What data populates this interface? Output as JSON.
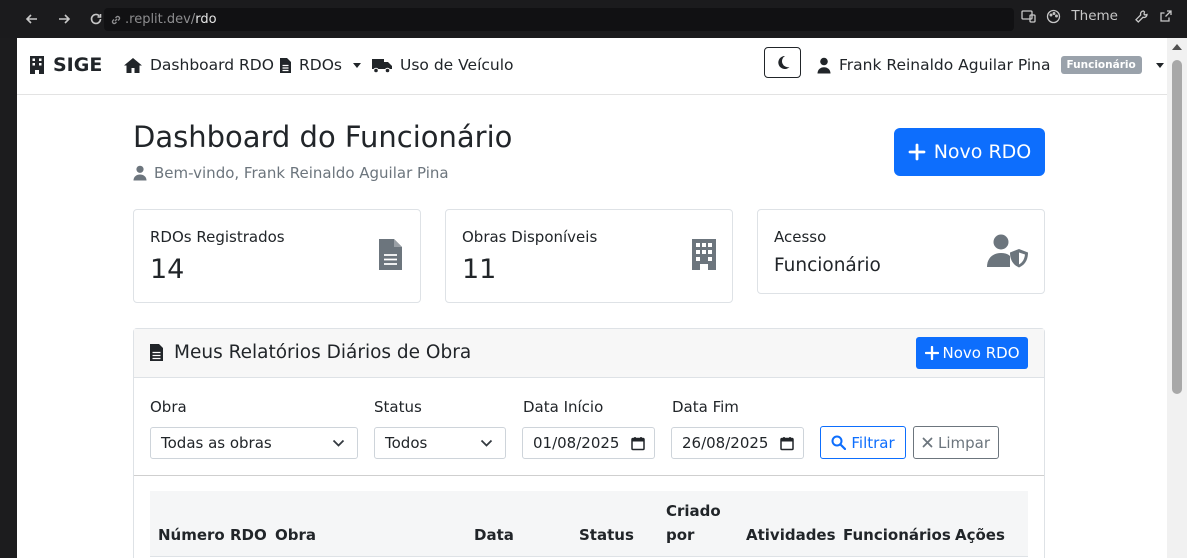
{
  "browser": {
    "url_domain": ".replit.dev/",
    "url_path": "rdo",
    "theme_label": "Theme"
  },
  "navbar": {
    "brand": "SIGE",
    "links": [
      {
        "label": "Dashboard RDO",
        "icon": "home-icon"
      },
      {
        "label": "RDOs",
        "icon": "file-icon",
        "dropdown": true
      },
      {
        "label": "Uso de Veículo",
        "icon": "truck-icon"
      }
    ],
    "user_name": "Frank Reinaldo Aguilar Pina",
    "user_role_badge": "Funcionário"
  },
  "header": {
    "title": "Dashboard do Funcionário",
    "welcome": "Bem-vindo, Frank Reinaldo Aguilar Pina",
    "new_rdo_button": "Novo RDO"
  },
  "stats": [
    {
      "label": "RDOs Registrados",
      "value": "14",
      "icon": "file-icon"
    },
    {
      "label": "Obras Disponíveis",
      "value": "11",
      "icon": "building-icon"
    },
    {
      "label": "Acesso",
      "value": "Funcionário",
      "icon": "user-shield-icon"
    }
  ],
  "panel": {
    "title": "Meus Relatórios Diários de Obra",
    "new_button": "Novo RDO",
    "filters": {
      "obra_label": "Obra",
      "obra_value": "Todas as obras",
      "status_label": "Status",
      "status_value": "Todos",
      "date_start_label": "Data Início",
      "date_start_value": "01/08/2025",
      "date_end_label": "Data Fim",
      "date_end_value": "26/08/2025",
      "filter_button": "Filtrar",
      "clear_button": "Limpar"
    },
    "table": {
      "columns": [
        "Número RDO",
        "Obra",
        "Data",
        "Status",
        "Criado por",
        "Atividades",
        "Funcionários",
        "Ações"
      ]
    }
  },
  "colors": {
    "primary": "#0d6efd",
    "badge": "#9aa2ab"
  }
}
